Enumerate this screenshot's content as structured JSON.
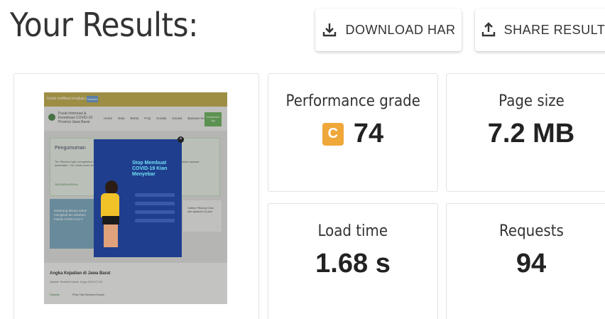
{
  "page": {
    "title": "Your Results:"
  },
  "actions": {
    "download_label": "DOWNLOAD HAR",
    "share_label": "SHARE RESULT"
  },
  "stats": {
    "performance": {
      "label": "Performance grade",
      "grade_letter": "C",
      "value": "74",
      "grade_color": "#f0a73a"
    },
    "page_size": {
      "label": "Page size",
      "value": "7.2 MB"
    },
    "load_time": {
      "label": "Load time",
      "value": "1.68 s"
    },
    "requests": {
      "label": "Requests",
      "value": "94"
    }
  },
  "screenshot": {
    "banner_text": "Untuk notifikasi lengkap pusat",
    "banner_button": "Aktifkan",
    "site_title": "Pusat Informasi & Koordinasi COVID-19",
    "site_subtitle": "Provinsi Jawa Barat",
    "nav": [
      "Home",
      "Data",
      "Berita",
      "FAQ",
      "Kontak",
      "Donasi",
      "Bantuan Sosial"
    ],
    "header_button": "Kontribusi Aja",
    "announcement_title": "Pengumuman",
    "announcement_text": "Tim Pikobar ingin mengetahui tingkat kepuasan dan kendala masyarakat Jawa Barat dalam menggunakan layanan kesehatan. Tuk, bantu kami dengan ikuti survei berikut.",
    "announcement_link": "SELENGKAPNYA",
    "side_text": "Sekarang dirinya untuk mengikuti tes sebelum masuk SARS-CoV-2",
    "popup_title": "Stop Membuat COVID-19 Kian Menyebar",
    "bottom_title": "Angka Kejadian di Jawa Barat",
    "bottom_sub": "Update Terakhir Kamis, 6 Agu 2020 07:20",
    "bottom_link": "Statistik",
    "bottom_item": "Peta Titik Sebaran Kasus",
    "side_box_text": "Hotline Pikobar Chat dan layanan 24 jam"
  }
}
